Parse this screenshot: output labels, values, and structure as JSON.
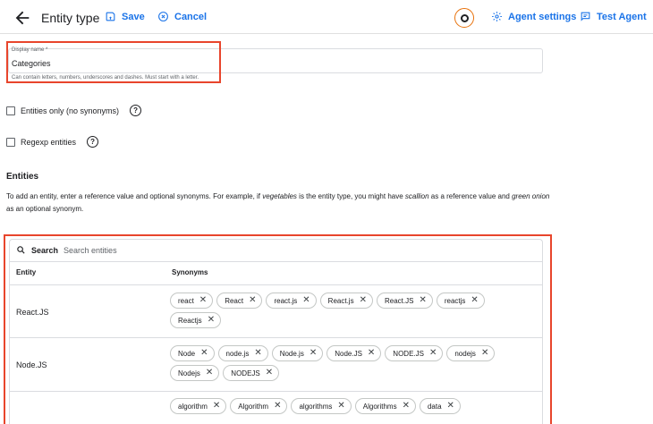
{
  "header": {
    "title": "Entity type",
    "save_label": "Save",
    "cancel_label": "Cancel",
    "agent_settings_label": "Agent settings",
    "test_agent_label": "Test Agent"
  },
  "display_name": {
    "label": "Display name *",
    "value": "Categories",
    "hint": "Can contain letters, numbers, underscores and dashes. Must start with a letter."
  },
  "options": {
    "entities_only_label": "Entities only (no synonyms)",
    "regexp_label": "Regexp entities"
  },
  "entities": {
    "title": "Entities",
    "desc_1": "To add an entity, enter a reference value and optional synonyms. For example, if ",
    "desc_em1": "vegetables",
    "desc_2": " is the entity type, you might have ",
    "desc_em2": "scallion",
    "desc_3": " as a reference value and ",
    "desc_em3": "green onion",
    "desc_4": " as an optional synonym.",
    "search_label": "Search",
    "search_placeholder": "Search entities",
    "col_entity": "Entity",
    "col_synonyms": "Synonyms",
    "rows": [
      {
        "entity": "React.JS",
        "synonyms": [
          "react",
          "React",
          "react.js",
          "React.js",
          "React.JS",
          "reactjs",
          "Reactjs"
        ]
      },
      {
        "entity": "Node.JS",
        "synonyms": [
          "Node",
          "node.js",
          "Node.js",
          "Node.JS",
          "NODE.JS",
          "nodejs",
          "Nodejs",
          "NODEJS"
        ]
      },
      {
        "entity": "",
        "synonyms": [
          "algorithm",
          "Algorithm",
          "algorithms",
          "Algorithms",
          "data"
        ]
      }
    ]
  },
  "colors": {
    "accent": "#1a73e8",
    "highlight": "#e8452c",
    "avatar_ring": "#e8710a"
  }
}
